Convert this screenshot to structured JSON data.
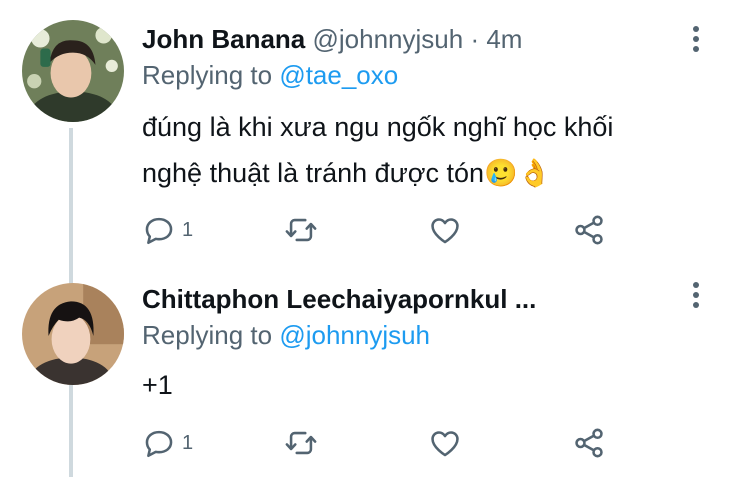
{
  "tweets": [
    {
      "author_name": "John Banana",
      "handle": "@johnnyjsuh",
      "separator": "·",
      "time": "4m",
      "replying_prefix": "Replying to",
      "replying_to": "@tae_oxo",
      "text_line1": "đúng là khi xưa ngu ngốk nghĩ học khối",
      "text_line2": "nghệ thuật là tránh được tón",
      "emoji": "🥲👌",
      "reply_count": "1",
      "icons": [
        "reply-icon",
        "retweet-icon",
        "like-icon",
        "share-icon",
        "more-icon"
      ]
    },
    {
      "author_name": "Chittaphon Leechaiyapornkul ...",
      "replying_prefix": "Replying to",
      "replying_to": "@johnnyjsuh",
      "text_line1": "+1",
      "reply_count": "1",
      "icons": [
        "reply-icon",
        "retweet-icon",
        "like-icon",
        "share-icon",
        "more-icon"
      ]
    }
  ],
  "colors": {
    "text": "#0f1419",
    "secondary": "#536471",
    "link": "#1d9bf0",
    "thread_line": "#cfd9de"
  }
}
